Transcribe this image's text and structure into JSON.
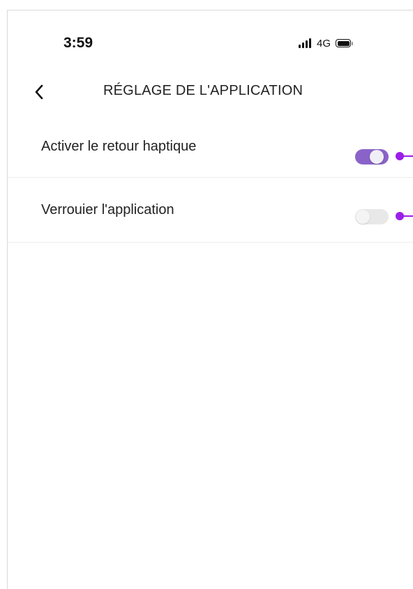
{
  "status_bar": {
    "time": "3:59",
    "network": "4G",
    "signal_icon": "signal-bars-icon",
    "battery_icon": "battery-icon"
  },
  "header": {
    "back_icon": "chevron-left-icon",
    "title": "RÉGLAGE DE L'APPLICATION"
  },
  "settings": [
    {
      "label": "Activer le retour haptique",
      "enabled": true
    },
    {
      "label": "Verrouier l'application",
      "enabled": false
    }
  ],
  "colors": {
    "toggle_on": "#8a63c9",
    "toggle_off": "#e8e8e8",
    "callout": "#9b1fe8"
  }
}
